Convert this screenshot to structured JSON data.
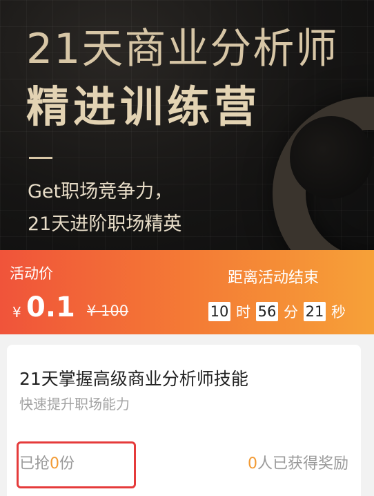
{
  "hero": {
    "title_line1": "21天商业分析师",
    "title_line2": "精进训练营",
    "tagline_line1": "Get职场竞争力，",
    "tagline_line2": "21天进阶职场精英"
  },
  "price_bar": {
    "label": "活动价",
    "currency": "¥",
    "price": "0.1",
    "original_price": "¥ 100",
    "countdown_title": "距离活动结束",
    "hours": "10",
    "hours_unit": "时",
    "minutes": "56",
    "minutes_unit": "分",
    "seconds": "21",
    "seconds_unit": "秒"
  },
  "course": {
    "title": "21天掌握高级商业分析师技能",
    "subtitle": "快速提升职场能力",
    "sold_prefix": "已抢",
    "sold_count": "0",
    "sold_suffix": "份",
    "reward_count": "0",
    "reward_suffix": "人已获得奖励"
  },
  "colors": {
    "price_gradient_start": "#f0543a",
    "price_gradient_end": "#f6a138",
    "gold_text": "#d7c6a6",
    "accent_orange": "#f29a33",
    "highlight_red": "#e53b3b"
  }
}
